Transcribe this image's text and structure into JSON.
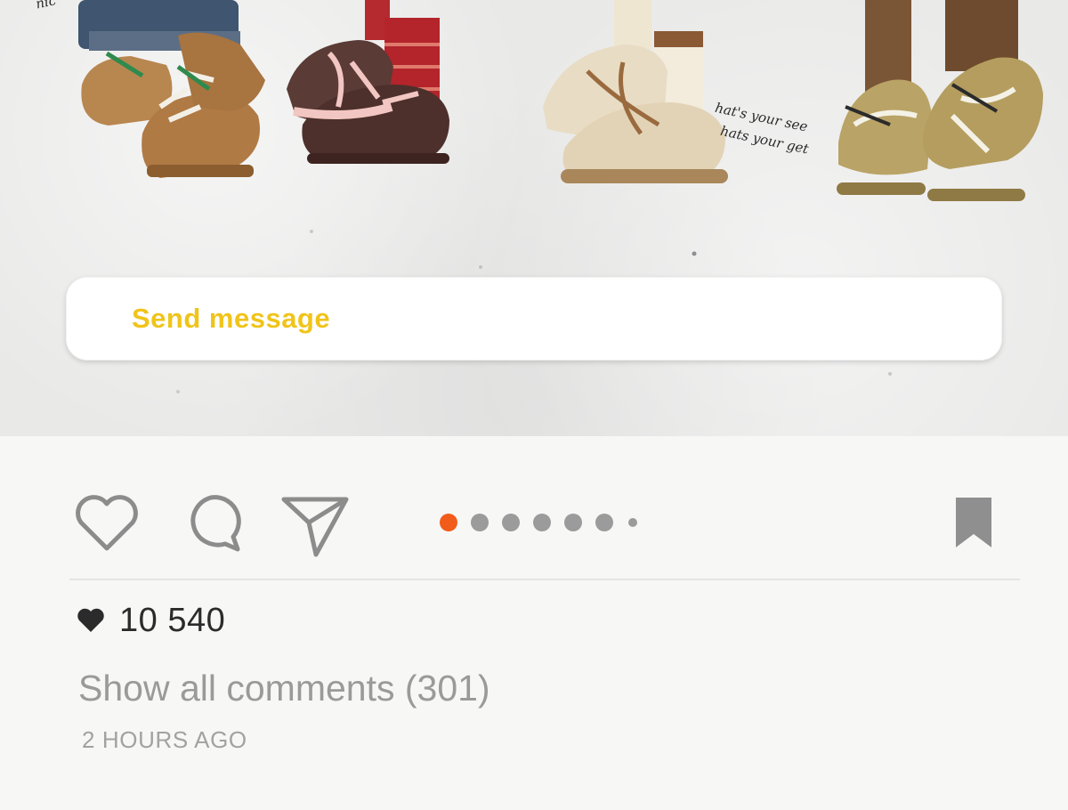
{
  "post": {
    "image": {
      "handwritten_notes": [
        "nic",
        "hat's your see",
        "hats your get"
      ]
    },
    "message_box": {
      "placeholder": "Send message"
    },
    "actions": {
      "like_icon": "heart-outline-icon",
      "comment_icon": "comment-bubble-icon",
      "share_icon": "paper-plane-icon",
      "save_icon": "bookmark-icon"
    },
    "carousel": {
      "total_dots": 7,
      "active_index": 0,
      "active_color": "#f25c1a",
      "inactive_color": "#9b9b9b"
    },
    "likes": {
      "icon": "heart-filled-icon",
      "count": "10 540"
    },
    "comments_link": "Show all comments (301)",
    "timestamp": "2 HOURS AGO"
  }
}
